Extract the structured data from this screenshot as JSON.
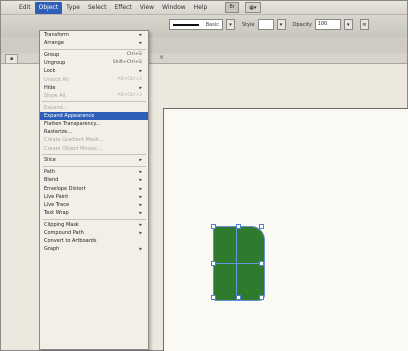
{
  "menubar": {
    "items": [
      "Edit",
      "Object",
      "Type",
      "Select",
      "Effect",
      "View",
      "Window",
      "Help"
    ],
    "active_index": 1,
    "badge": "Br",
    "workspace_icon": "arrange-documents-icon"
  },
  "controlbar": {
    "stroke_label": "Basic",
    "style_label": "Style",
    "opacity_label": "Opacity",
    "opacity_value": "100"
  },
  "menu": {
    "items": [
      {
        "label": "Transform",
        "shortcut": "",
        "submenu": true,
        "disabled": false
      },
      {
        "label": "Arrange",
        "shortcut": "",
        "submenu": true,
        "disabled": false
      },
      {
        "sep": true
      },
      {
        "label": "Group",
        "shortcut": "Ctrl+G",
        "submenu": false,
        "disabled": false
      },
      {
        "label": "Ungroup",
        "shortcut": "Shift+Ctrl+G",
        "submenu": false,
        "disabled": false
      },
      {
        "label": "Lock",
        "shortcut": "",
        "submenu": true,
        "disabled": false
      },
      {
        "label": "Unlock All",
        "shortcut": "Alt+Ctrl+2",
        "submenu": false,
        "disabled": true
      },
      {
        "label": "Hide",
        "shortcut": "",
        "submenu": true,
        "disabled": false
      },
      {
        "label": "Show All",
        "shortcut": "Alt+Ctrl+3",
        "submenu": false,
        "disabled": true
      },
      {
        "sep": true
      },
      {
        "label": "Expand...",
        "shortcut": "",
        "submenu": false,
        "disabled": true
      },
      {
        "label": "Expand Appearance",
        "shortcut": "",
        "submenu": false,
        "disabled": false,
        "selected": true
      },
      {
        "label": "Flatten Transparency...",
        "shortcut": "",
        "submenu": false,
        "disabled": false
      },
      {
        "label": "Rasterize...",
        "shortcut": "",
        "submenu": false,
        "disabled": false
      },
      {
        "label": "Create Gradient Mesh...",
        "shortcut": "",
        "submenu": false,
        "disabled": true
      },
      {
        "label": "Create Object Mosaic...",
        "shortcut": "",
        "submenu": false,
        "disabled": true
      },
      {
        "sep": true
      },
      {
        "label": "Slice",
        "shortcut": "",
        "submenu": true,
        "disabled": false
      },
      {
        "sep": true
      },
      {
        "label": "Path",
        "shortcut": "",
        "submenu": true,
        "disabled": false
      },
      {
        "label": "Blend",
        "shortcut": "",
        "submenu": true,
        "disabled": false
      },
      {
        "label": "Envelope Distort",
        "shortcut": "",
        "submenu": true,
        "disabled": false
      },
      {
        "label": "Live Paint",
        "shortcut": "",
        "submenu": true,
        "disabled": false
      },
      {
        "label": "Live Trace",
        "shortcut": "",
        "submenu": true,
        "disabled": false
      },
      {
        "label": "Text Wrap",
        "shortcut": "",
        "submenu": true,
        "disabled": false
      },
      {
        "sep": true
      },
      {
        "label": "Clipping Mask",
        "shortcut": "",
        "submenu": true,
        "disabled": false
      },
      {
        "label": "Compound Path",
        "shortcut": "",
        "submenu": true,
        "disabled": false
      },
      {
        "label": "Convert to Artboards",
        "shortcut": "",
        "submenu": false,
        "disabled": false
      },
      {
        "label": "Graph",
        "shortcut": "",
        "submenu": true,
        "disabled": false
      }
    ]
  },
  "colors": {
    "menu_highlight": "#2e5fb8",
    "shape_fill": "#2f7a2c",
    "selection": "#5d9be0"
  }
}
